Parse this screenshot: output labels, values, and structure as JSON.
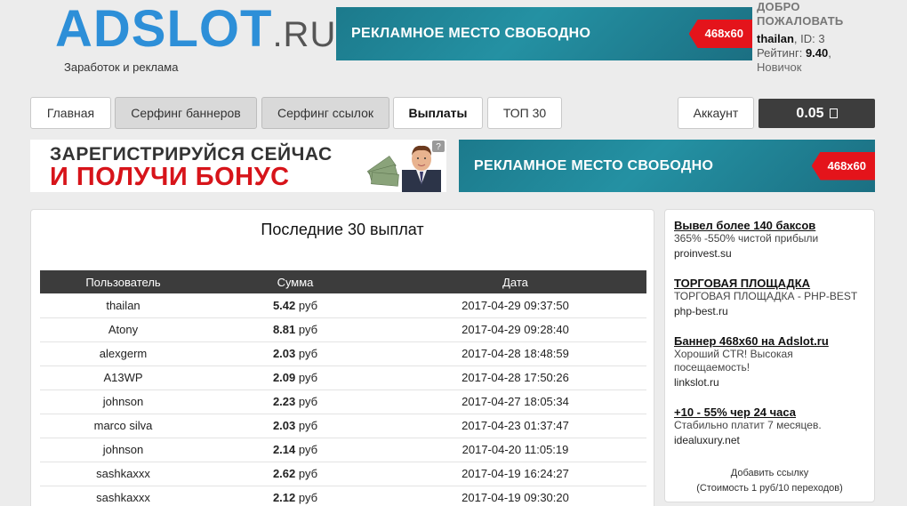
{
  "logo": {
    "main": "ADSLOT",
    "ru": ".RU",
    "subtitle": "Заработок и реклама"
  },
  "top_banner": {
    "text": "РЕКЛАМНОЕ  МЕСТО СВОБОДНО",
    "size": "468x60"
  },
  "user": {
    "welcome_line1": "ДОБРО",
    "welcome_line2": "ПОЖАЛОВАТЬ",
    "name": "thailan",
    "id_text": ", ID: 3",
    "rating_label": "Рейтинг: ",
    "rating_value": "9.40",
    "rating_suffix": ",",
    "rank": "Новичок"
  },
  "nav": {
    "home": "Главная",
    "banner_surf": "Серфинг баннеров",
    "link_surf": "Серфинг ссылок",
    "payouts": "Выплаты",
    "top30": "ТОП 30",
    "account": "Аккаунт",
    "balance": "0.05"
  },
  "promo": {
    "line1": "ЗАРЕГИСТРИРУЙСЯ СЕЙЧАС",
    "line2": "И ПОЛУЧИ БОНУС",
    "help": "?"
  },
  "mid_banner": {
    "text": "РЕКЛАМНОЕ  МЕСТО СВОБОДНО",
    "size": "468x60"
  },
  "payouts": {
    "title": "Последние 30 выплат",
    "headers": [
      "Пользователь",
      "Сумма",
      "Дата"
    ],
    "currency": "руб",
    "rows": [
      {
        "user": "thailan",
        "amount": "5.42",
        "date": "2017-04-29 09:37:50"
      },
      {
        "user": "Atony",
        "amount": "8.81",
        "date": "2017-04-29 09:28:40"
      },
      {
        "user": "alexgerm",
        "amount": "2.03",
        "date": "2017-04-28 18:48:59"
      },
      {
        "user": "A13WP",
        "amount": "2.09",
        "date": "2017-04-28 17:50:26"
      },
      {
        "user": "johnson",
        "amount": "2.23",
        "date": "2017-04-27 18:05:34"
      },
      {
        "user": "marco silva",
        "amount": "2.03",
        "date": "2017-04-23 01:37:47"
      },
      {
        "user": "johnson",
        "amount": "2.14",
        "date": "2017-04-20 11:05:19"
      },
      {
        "user": "sashkaxxx",
        "amount": "2.62",
        "date": "2017-04-19 16:24:27"
      },
      {
        "user": "sashkaxxx",
        "amount": "2.12",
        "date": "2017-04-19 09:30:20"
      }
    ]
  },
  "side_ads": [
    {
      "title": "Вывел более 140 баксов",
      "desc": "365% -550% чистой прибыли",
      "url": "proinvest.su"
    },
    {
      "title": "ТОРГОВАЯ ПЛОЩАДКА",
      "desc": "ТОРГОВАЯ ПЛОЩАДКА - PHP-BEST",
      "url": "php-best.ru"
    },
    {
      "title": "Баннер 468x60 на Adslot.ru",
      "desc": "Хороший CTR! Высокая посещаемость!",
      "url": "linkslot.ru"
    },
    {
      "title": "+10 - 55% чер 24 часа",
      "desc": "Стабильно платит 7 месяцев.",
      "url": "idealuxury.net"
    }
  ],
  "add_link": {
    "line1": "Добавить ссылку",
    "line2": "(Стоимость 1 руб/10 переходов)"
  }
}
